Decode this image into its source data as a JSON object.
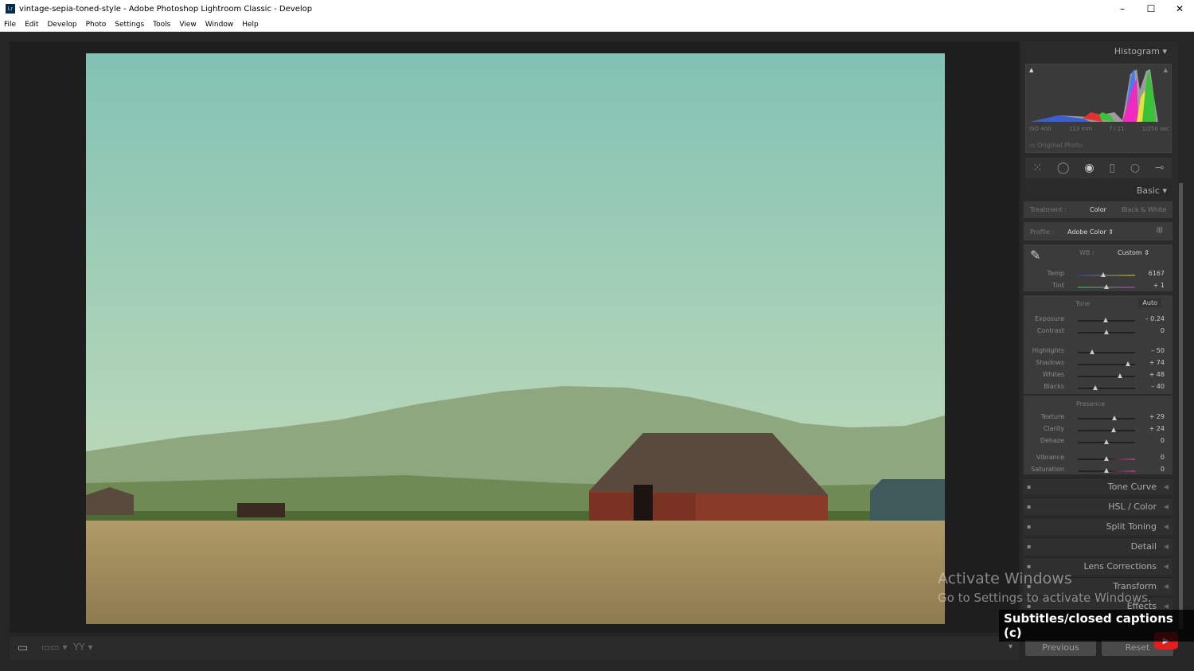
{
  "window": {
    "title": "vintage-sepia-toned-style - Adobe Photoshop Lightroom Classic - Develop",
    "logo": "Lr",
    "minimize": "–",
    "maximize": "☐",
    "close": "✕"
  },
  "menu": [
    "File",
    "Edit",
    "Develop",
    "Photo",
    "Settings",
    "Tools",
    "View",
    "Window",
    "Help"
  ],
  "histogram": {
    "title": "Histogram",
    "iso": "ISO 400",
    "focal": "113 mm",
    "aperture": "f / 11",
    "shutter": "1/250 sec",
    "original_photo": "Original Photo"
  },
  "basic": {
    "title": "Basic",
    "treatment_label": "Treatment :",
    "treatment_color": "Color",
    "treatment_bw": "Black & White",
    "profile_label": "Profile :",
    "profile_value": "Adobe Color ⇕",
    "wb_label": "WB :",
    "wb_value": "Custom ⇕",
    "tone_label": "Tone",
    "auto": "Auto",
    "presence_label": "Presence",
    "sliders": [
      {
        "label": "Temp",
        "value": "6167",
        "pos": 0.45,
        "track": "temp"
      },
      {
        "label": "Tint",
        "value": "+ 1",
        "pos": 0.5,
        "track": "tint"
      },
      {
        "label": "Exposure",
        "value": "– 0.24",
        "pos": 0.48
      },
      {
        "label": "Contrast",
        "value": "0",
        "pos": 0.5
      },
      {
        "label": "Highlights",
        "value": "– 50",
        "pos": 0.25
      },
      {
        "label": "Shadows",
        "value": "+ 74",
        "pos": 0.87
      },
      {
        "label": "Whites",
        "value": "+ 48",
        "pos": 0.74
      },
      {
        "label": "Blacks",
        "value": "– 40",
        "pos": 0.3
      },
      {
        "label": "Texture",
        "value": "+ 29",
        "pos": 0.645
      },
      {
        "label": "Clarity",
        "value": "+ 24",
        "pos": 0.62
      },
      {
        "label": "Dehaze",
        "value": "0",
        "pos": 0.5
      },
      {
        "label": "Vibrance",
        "value": "0",
        "pos": 0.5,
        "track": "sat"
      },
      {
        "label": "Saturation",
        "value": "0",
        "pos": 0.5,
        "track": "sat"
      }
    ]
  },
  "collapsed_panels": [
    "Tone Curve",
    "HSL / Color",
    "Split Toning",
    "Detail",
    "Lens Corrections",
    "Transform",
    "Effects"
  ],
  "buttons": {
    "previous": "Previous",
    "reset": "Reset"
  },
  "overlay": {
    "activate_title": "Activate Windows",
    "activate_sub": "Go to Settings to activate Windows.",
    "captions": "Subtitles/closed captions (c)"
  }
}
